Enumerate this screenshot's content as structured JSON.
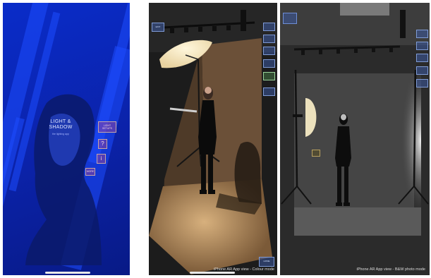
{
  "screen1": {
    "title_line1": "LIGHT &",
    "title_line2": "SHADOW",
    "subtitle": "the lighting app",
    "start_button": "LIGHT SETUPS",
    "help_button": "?",
    "info_button": "i",
    "more_button": "MORE"
  },
  "screen2": {
    "back_button": "EXIT",
    "home_button": "HOME",
    "caption": "iPhone AR App view - Colour mode"
  },
  "screen3": {
    "caption": "iPhone AR App view - B&W photo mode"
  },
  "colors": {
    "blue_bg": "#0b22a8",
    "backdrop": "#6b5038",
    "floor": "#a07b55",
    "ui_blue": "#3c5aa0",
    "ui_red": "#c84678"
  }
}
